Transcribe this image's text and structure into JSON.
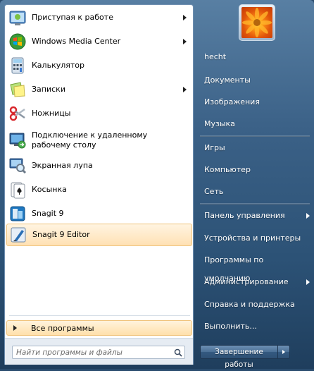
{
  "programs": [
    {
      "label": "Приступая к работе",
      "icon": "getting-started-icon",
      "submenu": true
    },
    {
      "label": "Windows Media Center",
      "icon": "windows-media-center-icon",
      "submenu": true
    },
    {
      "label": "Калькулятор",
      "icon": "calculator-icon",
      "submenu": false
    },
    {
      "label": "Записки",
      "icon": "sticky-notes-icon",
      "submenu": true
    },
    {
      "label": "Ножницы",
      "icon": "scissors-icon",
      "submenu": false
    },
    {
      "label": "Подключение к удаленному рабочему столу",
      "icon": "remote-desktop-icon",
      "submenu": false
    },
    {
      "label": "Экранная лупа",
      "icon": "magnifier-icon",
      "submenu": false
    },
    {
      "label": "Косынка",
      "icon": "solitaire-icon",
      "submenu": false
    },
    {
      "label": "Snagit 9",
      "icon": "snagit-icon",
      "submenu": false
    },
    {
      "label": "Snagit 9 Editor",
      "icon": "snagit-editor-icon",
      "submenu": false,
      "highlighted": true
    }
  ],
  "all_programs": "Все программы",
  "search": {
    "placeholder": "Найти программы и файлы"
  },
  "user": {
    "name": "hecht"
  },
  "right_items": [
    {
      "label": "hecht"
    },
    {
      "label": "Документы"
    },
    {
      "label": "Изображения"
    },
    {
      "label": "Музыка"
    },
    {
      "label": "Игры"
    },
    {
      "label": "Компьютер"
    },
    {
      "label": "Сеть"
    },
    {
      "label": "Панель управления",
      "submenu": true
    },
    {
      "label": "Устройства и принтеры"
    },
    {
      "label": "Программы по умолчанию"
    },
    {
      "label": "Администрирование",
      "submenu": true
    },
    {
      "label": "Справка и поддержка"
    },
    {
      "label": "Выполнить..."
    }
  ],
  "shutdown": {
    "label": "Завершение работы"
  },
  "colors": {
    "highlight": "#ffe1b4",
    "panel": "#3b6187",
    "accent": "#f47a12"
  }
}
